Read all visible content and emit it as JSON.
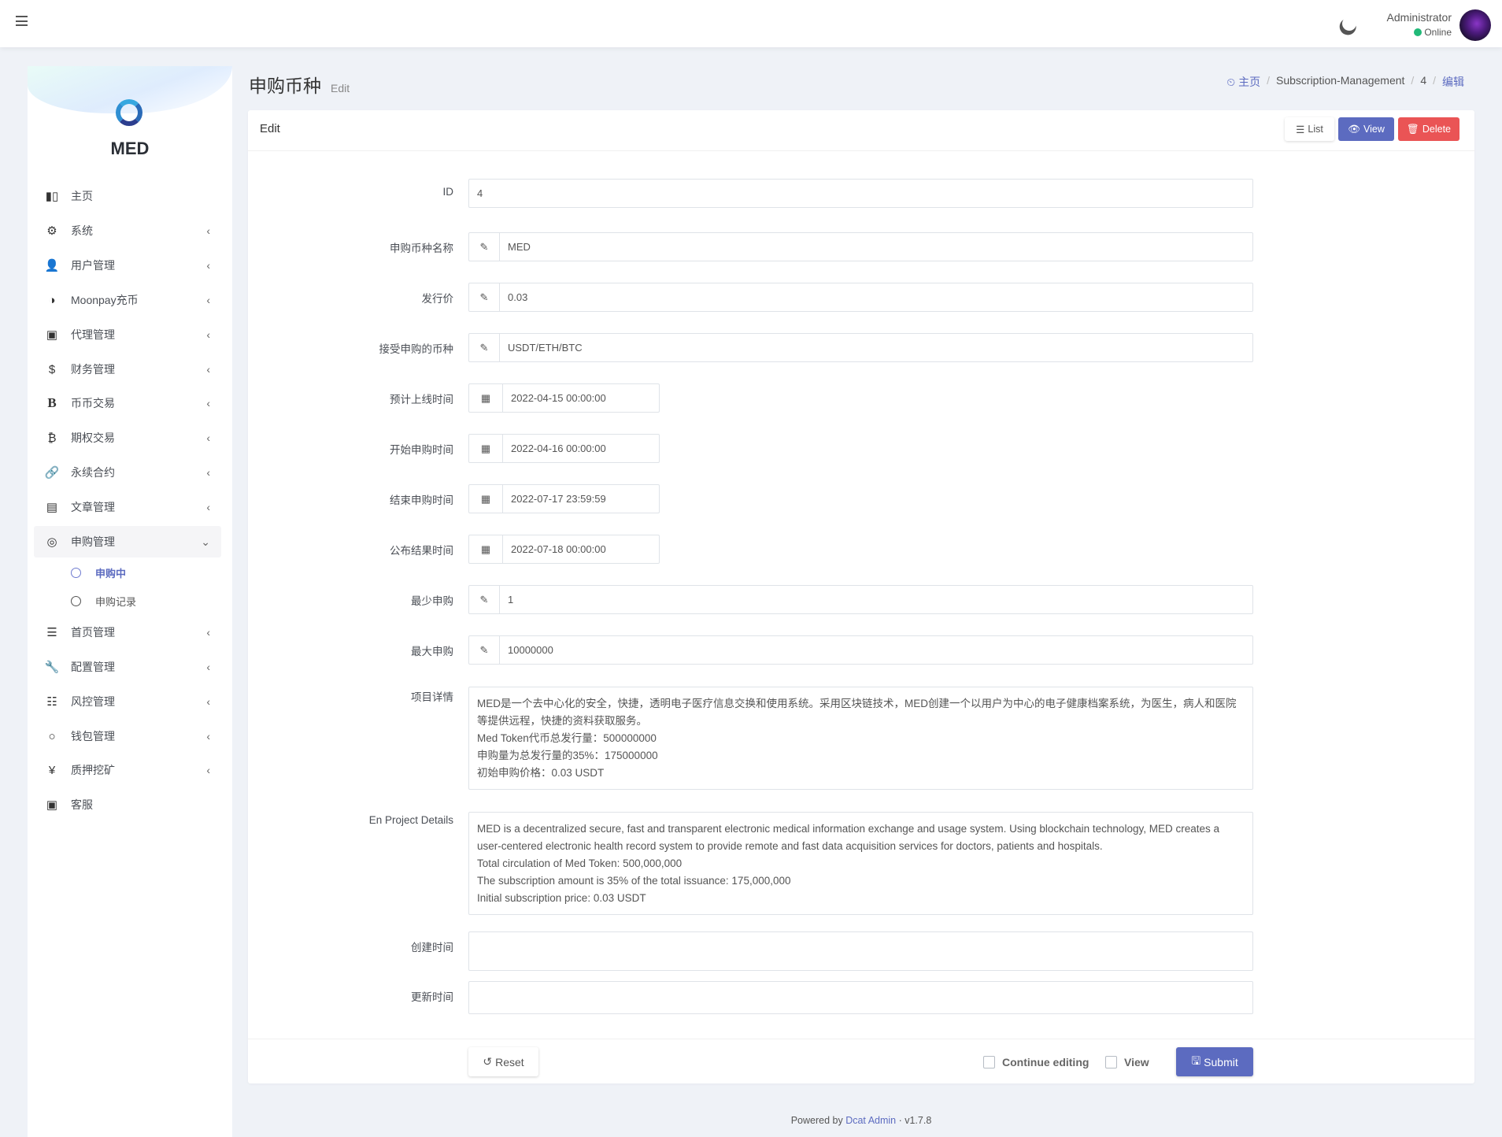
{
  "header": {
    "user_name": "Administrator",
    "status": "Online",
    "status_color": "#21b978"
  },
  "sidebar": {
    "brand": "MED",
    "items": [
      {
        "label": "主页",
        "icon": "bar-chart-icon",
        "expandable": false
      },
      {
        "label": "系统",
        "icon": "gear-icon",
        "expandable": true
      },
      {
        "label": "用户管理",
        "icon": "users-icon",
        "expandable": true
      },
      {
        "label": "Moonpay充币",
        "icon": "half-circle-icon",
        "expandable": true
      },
      {
        "label": "代理管理",
        "icon": "id-card-icon",
        "expandable": true
      },
      {
        "label": "财务管理",
        "icon": "dollar-icon",
        "expandable": true
      },
      {
        "label": "币币交易",
        "icon": "bold-b-icon",
        "expandable": true
      },
      {
        "label": "期权交易",
        "icon": "bitcoin-icon",
        "expandable": true
      },
      {
        "label": "永续合约",
        "icon": "link-icon",
        "expandable": true
      },
      {
        "label": "文章管理",
        "icon": "newspaper-icon",
        "expandable": true
      },
      {
        "label": "申购管理",
        "icon": "life-ring-icon",
        "expandable": true,
        "open": true
      }
    ],
    "subitems": [
      {
        "label": "申购中",
        "active": true
      },
      {
        "label": "申购记录",
        "active": false
      }
    ],
    "items_after": [
      {
        "label": "首页管理",
        "icon": "bars-icon",
        "expandable": true
      },
      {
        "label": "配置管理",
        "icon": "wrench-icon",
        "expandable": true
      },
      {
        "label": "风控管理",
        "icon": "outdent-icon",
        "expandable": true
      },
      {
        "label": "钱包管理",
        "icon": "circle-icon",
        "expandable": true
      },
      {
        "label": "质押挖矿",
        "icon": "yen-icon",
        "expandable": true
      },
      {
        "label": "客服",
        "icon": "id-card-icon",
        "expandable": false
      }
    ]
  },
  "page": {
    "title": "申购币种",
    "subtitle": "Edit"
  },
  "breadcrumb": {
    "home": "主页",
    "section": "Subscription-Management",
    "id": "4",
    "current": "编辑"
  },
  "card": {
    "title": "Edit",
    "list": "List",
    "view": "View",
    "delete": "Delete"
  },
  "form": {
    "id": {
      "label": "ID",
      "value": "4"
    },
    "name": {
      "label": "申购币种名称",
      "value": "MED"
    },
    "price": {
      "label": "发行价",
      "value": "0.03"
    },
    "accepted": {
      "label": "接受申购的币种",
      "value": "USDT/ETH/BTC"
    },
    "launch_time": {
      "label": "预计上线时间",
      "value": "2022-04-15 00:00:00"
    },
    "start_time": {
      "label": "开始申购时间",
      "value": "2022-04-16 00:00:00"
    },
    "end_time": {
      "label": "结束申购时间",
      "value": "2022-07-17 23:59:59"
    },
    "result_time": {
      "label": "公布结果时间",
      "value": "2022-07-18 00:00:00"
    },
    "min": {
      "label": "最少申购",
      "value": "1"
    },
    "max": {
      "label": "最大申购",
      "value": "10000000"
    },
    "details": {
      "label": "项目详情",
      "value": "MED是一个去中心化的安全，快捷，透明电子医疗信息交换和使用系统。采用区块链技术，MED创建一个以用户为中心的电子健康档案系统，为医生，病人和医院等提供远程，快捷的资料获取服务。\nMed Token代币总发行量：500000000\n申购量为总发行量的35%：175000000\n初始申购价格：0.03 USDT"
    },
    "en_details": {
      "label": "En Project Details",
      "value": "MED is a decentralized secure, fast and transparent electronic medical information exchange and usage system. Using blockchain technology, MED creates a user-centered electronic health record system to provide remote and fast data acquisition services for doctors, patients and hospitals.\nTotal circulation of Med Token: 500,000,000\nThe subscription amount is 35% of the total issuance: 175,000,000\nInitial subscription price: 0.03 USDT"
    },
    "created": {
      "label": "创建时间",
      "value": ""
    },
    "updated": {
      "label": "更新时间",
      "value": ""
    }
  },
  "footer_actions": {
    "reset": "Reset",
    "continue_editing": "Continue editing",
    "view": "View",
    "submit": "Submit"
  },
  "footer": {
    "powered": "Powered by",
    "brand": "Dcat Admin",
    "version": "v1.7.8"
  },
  "colors": {
    "primary": "#5c6bc0",
    "danger": "#ea5455"
  }
}
